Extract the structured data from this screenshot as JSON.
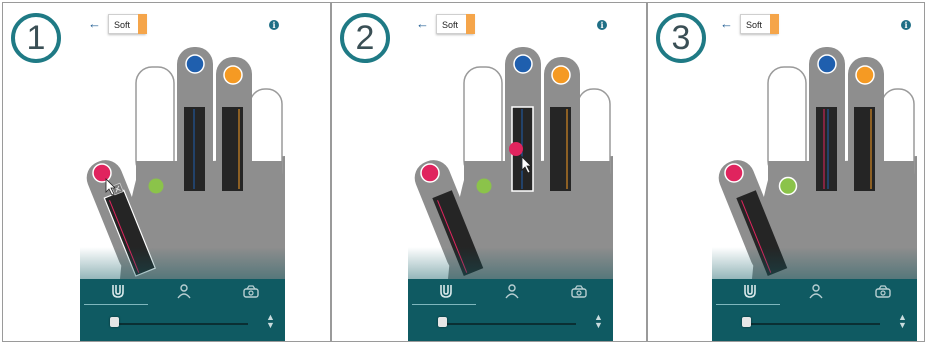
{
  "steps": [
    {
      "number": "1",
      "mode_label": "Soft",
      "active_finger": "thumb",
      "colors": {
        "thumb": "#e0245e",
        "index": "#8bc34a",
        "middle": "#1f5fae",
        "ring": "#f59a23"
      }
    },
    {
      "number": "2",
      "mode_label": "Soft",
      "active_finger": "middle",
      "colors": {
        "thumb": "#e0245e",
        "index": "#8bc34a",
        "middle": "#1f5fae",
        "ring": "#f59a23"
      }
    },
    {
      "number": "3",
      "mode_label": "Soft",
      "active_finger": "none",
      "colors": {
        "thumb": "#e0245e",
        "index": "#8bc34a",
        "middle": "#1f5fae",
        "ring": "#f59a23"
      }
    }
  ],
  "icons": {
    "back": "back-arrow-icon",
    "info": "info-icon",
    "tab_1": "grip-magnet-icon",
    "tab_2": "person-icon",
    "tab_3": "hand-camera-icon",
    "stepper": "up-down-stepper-icon"
  },
  "colors": {
    "badge_ring": "#1f7a85",
    "bottom_bar": "#0f5a62",
    "hand_fill": "#8e8e8e",
    "finger_outline_fill": "#ffffff",
    "mode_accent": "#f5a54a"
  }
}
